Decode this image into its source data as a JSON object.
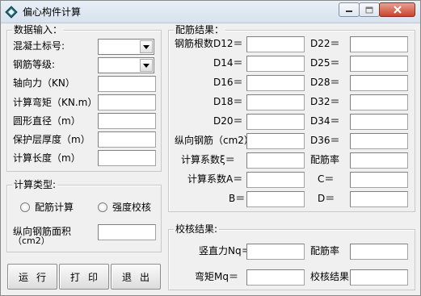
{
  "window": {
    "title": "偏心构件计算"
  },
  "input": {
    "group_title": "数据输入：",
    "concrete_grade": "混凝土标号:",
    "rebar_grade": "钢筋等级:",
    "axial_force": "轴向力（KN）",
    "moment": "计算弯矩（KN.m）",
    "diameter": "圆形直径（m）",
    "cover": "保护层厚度（m）",
    "length": "计算长度（m）"
  },
  "calc_type": {
    "group_title": "计算类型:",
    "option_rebar": "配筋计算",
    "option_strength": "强度校核",
    "area_label_1": "纵向钢筋面积",
    "area_label_2": "（cm2）"
  },
  "buttons": {
    "run": "运行",
    "print": "打印",
    "exit": "退出"
  },
  "result": {
    "group_title": "配筋结果：",
    "d12": "钢筋根数D12＝",
    "d14": "D14＝",
    "d16": "D16＝",
    "d18": "D18＝",
    "d20": "D20＝",
    "d22": "D22＝",
    "d25": "D25＝",
    "d28": "D28＝",
    "d32": "D32＝",
    "d34": "D34＝",
    "d36": "D36＝",
    "long_rebar": "纵向钢筋（cm2）",
    "coef_xi": "计算系数ξ＝",
    "ratio": "配筋率",
    "coef_a": "计算系数A＝",
    "c": "C＝",
    "b": "B＝",
    "d": "D＝"
  },
  "check": {
    "group_title": "校核结果:",
    "nq": "竖直力Nq＝",
    "ratio": "配筋率",
    "mq": "弯矩Mq＝",
    "result": "校核结果"
  }
}
